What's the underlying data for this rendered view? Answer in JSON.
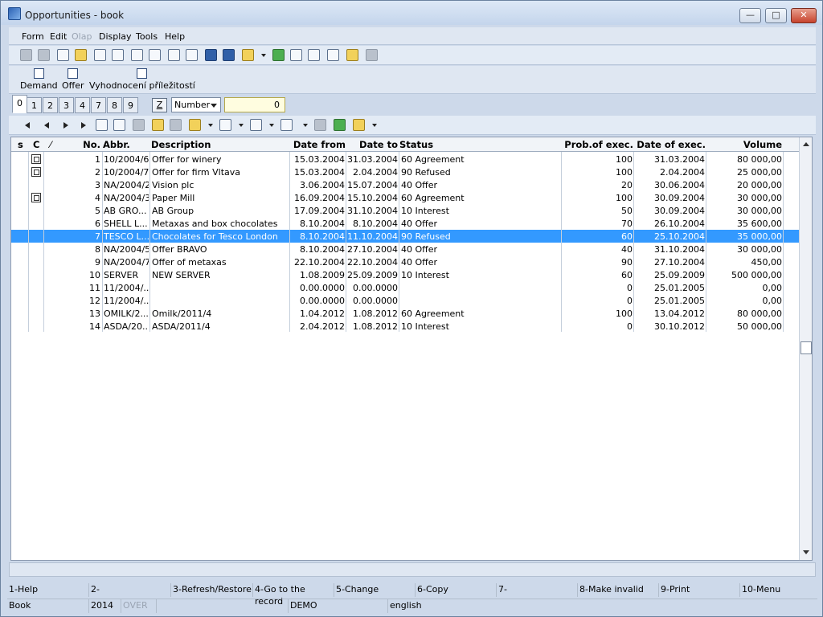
{
  "window": {
    "title": "Opportunities - book",
    "min": "—",
    "max": "□",
    "close": "✕"
  },
  "menu": [
    {
      "label": "Form",
      "disabled": false
    },
    {
      "label": "Edit",
      "disabled": false
    },
    {
      "label": "Olap",
      "disabled": true
    },
    {
      "label": "Display",
      "disabled": false
    },
    {
      "label": "Tools",
      "disabled": false
    },
    {
      "label": "Help",
      "disabled": false
    }
  ],
  "actions": [
    "Demand",
    "Offer",
    "Vyhodnocení příležitostí"
  ],
  "tabs": [
    "0",
    "1",
    "2",
    "3",
    "4",
    "7",
    "8",
    "9"
  ],
  "active_tab": "0",
  "filter": {
    "z_label": "Z",
    "field": "Number",
    "value": "0"
  },
  "grid": {
    "headers": {
      "s": "s",
      "c": "C",
      "sort": "⁄",
      "no": "No.",
      "abbr": "Abbr.",
      "desc": "Description",
      "from": "Date from",
      "to": "Date to",
      "status": "Status",
      "prob": "Prob.of exec.",
      "exec": "Date of exec.",
      "volume": "Volume"
    },
    "rows": [
      {
        "no": "1",
        "abbr": "10/2004/6",
        "desc": "Offer for winery",
        "from": "15.03.2004",
        "to": "31.03.2004",
        "status": "60 Agreement",
        "prob": "100",
        "exec": "31.03.2004",
        "volume": "80 000,00",
        "doc": true
      },
      {
        "no": "2",
        "abbr": "10/2004/7",
        "desc": "Offer for firm Vltava",
        "from": "15.03.2004",
        "to": "2.04.2004",
        "status": "90 Refused",
        "prob": "100",
        "exec": "2.04.2004",
        "volume": "25 000,00",
        "doc": true
      },
      {
        "no": "3",
        "abbr": "NA/2004/2",
        "desc": "Vision plc",
        "from": "3.06.2004",
        "to": "15.07.2004",
        "status": "40 Offer",
        "prob": "20",
        "exec": "30.06.2004",
        "volume": "20 000,00",
        "doc": false
      },
      {
        "no": "4",
        "abbr": "NA/2004/3",
        "desc": "Paper Mill",
        "from": "16.09.2004",
        "to": "15.10.2004",
        "status": "60 Agreement",
        "prob": "100",
        "exec": "30.09.2004",
        "volume": "30 000,00",
        "doc": true
      },
      {
        "no": "5",
        "abbr": "AB GRO...",
        "desc": "AB Group",
        "from": "17.09.2004",
        "to": "31.10.2004",
        "status": "10 Interest",
        "prob": "50",
        "exec": "30.09.2004",
        "volume": "30 000,00",
        "doc": false
      },
      {
        "no": "6",
        "abbr": "SHELL L...",
        "desc": "Metaxas and box chocolates",
        "from": "8.10.2004",
        "to": "8.10.2004",
        "status": "40 Offer",
        "prob": "70",
        "exec": "26.10.2004",
        "volume": "35 600,00",
        "doc": false
      },
      {
        "no": "7",
        "abbr": "TESCO L...",
        "desc": "Chocolates for Tesco London",
        "from": "8.10.2004",
        "to": "11.10.2004",
        "status": "90 Refused",
        "prob": "60",
        "exec": "25.10.2004",
        "volume": "35 000,00",
        "doc": false,
        "selected": true
      },
      {
        "no": "8",
        "abbr": "NA/2004/5",
        "desc": "Offer BRAVO",
        "from": "8.10.2004",
        "to": "27.10.2004",
        "status": "40 Offer",
        "prob": "40",
        "exec": "31.10.2004",
        "volume": "30 000,00",
        "doc": false
      },
      {
        "no": "9",
        "abbr": "NA/2004/7",
        "desc": "Offer of metaxas",
        "from": "22.10.2004",
        "to": "22.10.2004",
        "status": "40 Offer",
        "prob": "90",
        "exec": "27.10.2004",
        "volume": "450,00",
        "doc": false
      },
      {
        "no": "10",
        "abbr": "SERVER",
        "desc": "NEW SERVER",
        "from": "1.08.2009",
        "to": "25.09.2009",
        "status": "10 Interest",
        "prob": "60",
        "exec": "25.09.2009",
        "volume": "500 000,00",
        "doc": false
      },
      {
        "no": "11",
        "abbr": "11/2004/...",
        "desc": "",
        "from": "0.00.0000",
        "to": "0.00.0000",
        "status": "",
        "prob": "0",
        "exec": "25.01.2005",
        "volume": "0,00",
        "doc": false
      },
      {
        "no": "12",
        "abbr": "11/2004/...",
        "desc": "",
        "from": "0.00.0000",
        "to": "0.00.0000",
        "status": "",
        "prob": "0",
        "exec": "25.01.2005",
        "volume": "0,00",
        "doc": false
      },
      {
        "no": "13",
        "abbr": "OMILK/2...",
        "desc": "Omilk/2011/4",
        "from": "1.04.2012",
        "to": "1.08.2012",
        "status": "60 Agreement",
        "prob": "100",
        "exec": "13.04.2012",
        "volume": "80 000,00",
        "doc": false
      },
      {
        "no": "14",
        "abbr": "ASDA/20...",
        "desc": "ASDA/2011/4",
        "from": "2.04.2012",
        "to": "1.08.2012",
        "status": "10 Interest",
        "prob": "0",
        "exec": "30.10.2012",
        "volume": "50 000,00",
        "doc": false
      }
    ]
  },
  "fkeys": [
    "1-Help",
    "2-",
    "3-Refresh/Restore",
    "4-Go to the record",
    "5-Change",
    "6-Copy",
    "7-",
    "8-Make invalid",
    "9-Print",
    "10-Menu"
  ],
  "status": {
    "module": "Book",
    "year": "2014",
    "mode": "OVER",
    "blank1": "",
    "db": "DEMO",
    "lang": "english"
  }
}
